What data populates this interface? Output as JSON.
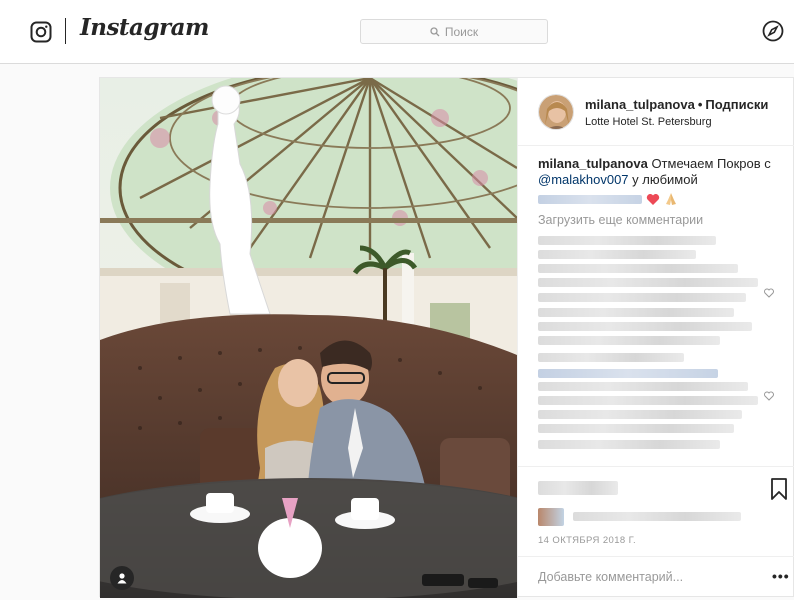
{
  "header": {
    "wordmark": "Instagram",
    "search_placeholder": "Поиск",
    "logo_icon": "instagram-camera-icon",
    "explore_icon": "compass-icon"
  },
  "post": {
    "username": "milana_tulpanova",
    "follow_label": "Подписки",
    "location": "Lotte Hotel St. Petersburg",
    "caption": {
      "username": "milana_tulpanova",
      "text": "Отмечаем Покров с",
      "mention": "@malakhov007",
      "text_after": "у любимой"
    },
    "load_more": "Загрузить еще комментарии",
    "date": "14 ОКТЯБРЯ 2018 Г.",
    "add_comment_placeholder": "Добавьте комментарий...",
    "more_label": "•••",
    "colors": {
      "link": "#003569",
      "muted": "#999999",
      "heart": "#ed4956"
    }
  }
}
